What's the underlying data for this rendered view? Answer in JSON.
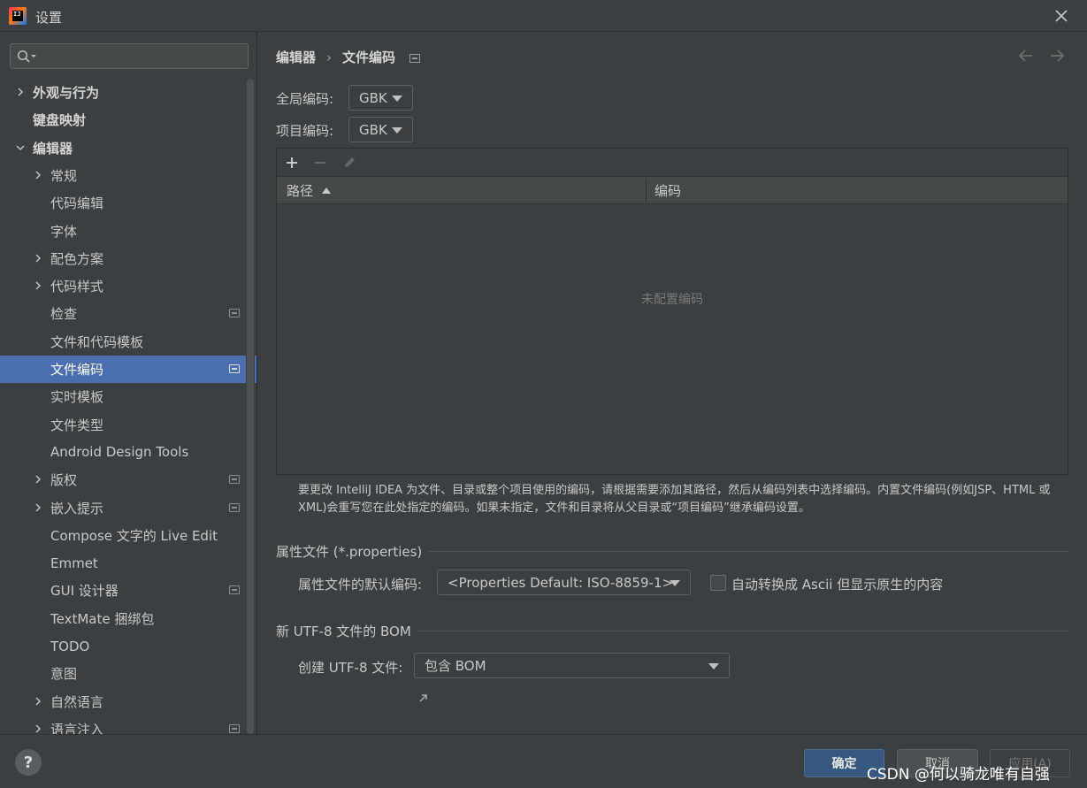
{
  "window": {
    "title": "设置"
  },
  "search": {
    "placeholder": ""
  },
  "sidebar": {
    "items": [
      {
        "label": "外观与行为",
        "expandable": true,
        "expanded": false,
        "bold": true
      },
      {
        "label": "键盘映射",
        "expandable": false,
        "bold": true
      },
      {
        "label": "编辑器",
        "expandable": true,
        "expanded": true,
        "bold": true
      },
      {
        "label": "常规",
        "expandable": true,
        "expanded": false
      },
      {
        "label": "代码编辑",
        "expandable": false
      },
      {
        "label": "字体",
        "expandable": false
      },
      {
        "label": "配色方案",
        "expandable": true,
        "expanded": false
      },
      {
        "label": "代码样式",
        "expandable": true,
        "expanded": false
      },
      {
        "label": "检查",
        "expandable": false,
        "badge": true
      },
      {
        "label": "文件和代码模板",
        "expandable": false
      },
      {
        "label": "文件编码",
        "expandable": false,
        "badge": true,
        "selected": true
      },
      {
        "label": "实时模板",
        "expandable": false
      },
      {
        "label": "文件类型",
        "expandable": false
      },
      {
        "label": "Android Design Tools",
        "expandable": false
      },
      {
        "label": "版权",
        "expandable": true,
        "expanded": false,
        "badge": true
      },
      {
        "label": "嵌入提示",
        "expandable": true,
        "expanded": false,
        "badge": true
      },
      {
        "label": "Compose 文字的 Live Edit",
        "expandable": false
      },
      {
        "label": "Emmet",
        "expandable": false
      },
      {
        "label": "GUI 设计器",
        "expandable": false,
        "badge": true
      },
      {
        "label": "TextMate 捆绑包",
        "expandable": false
      },
      {
        "label": "TODO",
        "expandable": false
      },
      {
        "label": "意图",
        "expandable": false
      },
      {
        "label": "自然语言",
        "expandable": true,
        "expanded": false
      },
      {
        "label": "语言注入",
        "expandable": true,
        "expanded": false,
        "badge": true
      }
    ]
  },
  "breadcrumb": {
    "parent": "编辑器",
    "separator": "›",
    "current": "文件编码"
  },
  "global_encoding": {
    "label": "全局编码:",
    "value": "GBK"
  },
  "project_encoding": {
    "label": "项目编码:",
    "value": "GBK"
  },
  "table": {
    "toolbar": {
      "add": "+",
      "remove": "−"
    },
    "columns": [
      "路径",
      "编码"
    ],
    "empty_text": "未配置编码"
  },
  "hint": "要更改 IntelliJ IDEA 为文件、目录或整个项目使用的编码，请根据需要添加其路径，然后从编码列表中选择编码。内置文件编码(例如JSP、HTML 或 XML)会重写您在此处指定的编码。如果未指定，文件和目录将从父目录或“项目编码”继承编码设置。",
  "properties_section": {
    "title": "属性文件 (*.properties)",
    "default_label": "属性文件的默认编码:",
    "default_value": "<Properties Default: ISO-8859-1>",
    "transparent_label": "自动转换成 Ascii 但显示原生的内容",
    "transparent_checked": false
  },
  "bom_section": {
    "title": "新 UTF-8 文件的 BOM",
    "create_label": "创建 UTF-8 文件:",
    "create_value": "包含 BOM"
  },
  "footer": {
    "help": "?",
    "ok": "确定",
    "cancel": "取消",
    "apply": "应用(A)",
    "watermark": "CSDN @何以骑龙唯有自强"
  },
  "colors": {
    "background": "#3c3f41",
    "selection": "#4b6eaf",
    "primary_button": "#365880"
  }
}
